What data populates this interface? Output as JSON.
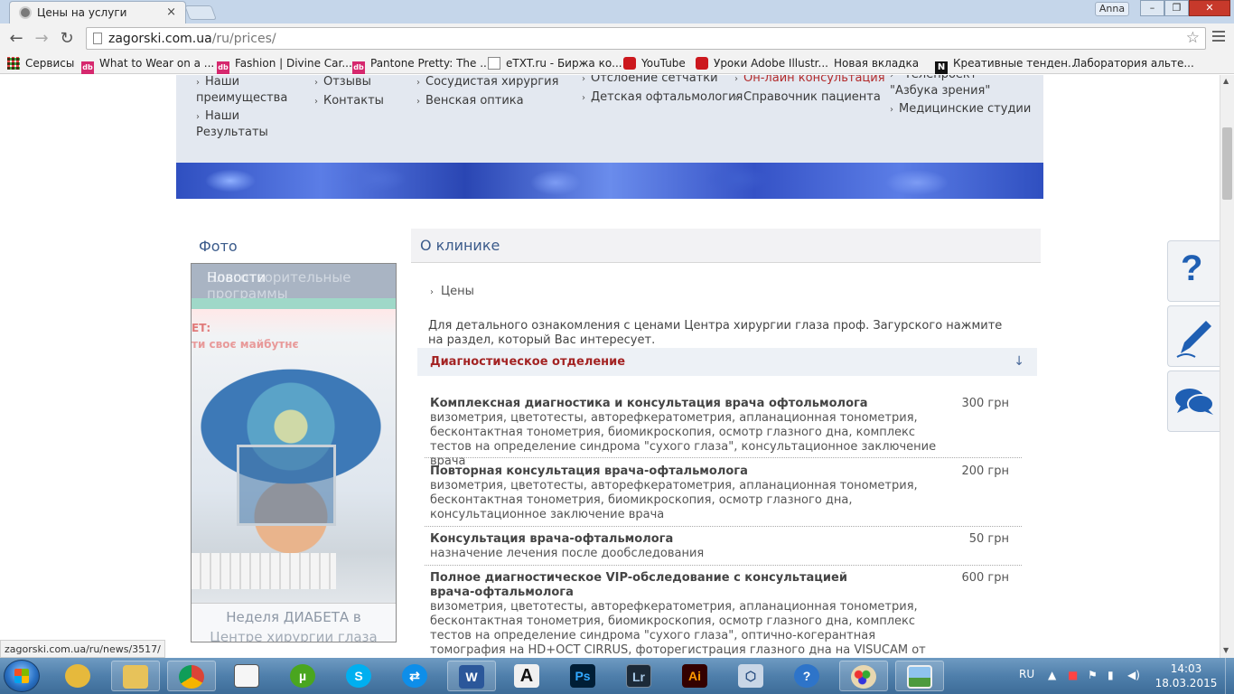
{
  "browser": {
    "tab_title": "Цены на услуги",
    "tab_close": "×",
    "user": "Anna",
    "window_buttons": [
      "–",
      "❐",
      "✕"
    ],
    "url_host": "zagorski.com.ua",
    "url_path": "/ru/prices/",
    "status_url": "zagorski.com.ua/ru/news/3517/"
  },
  "bookmarks": [
    {
      "label": "Сервисы",
      "icon": "apps-grid-icon"
    },
    {
      "label": "What to Wear on a ...",
      "icon": "dd-icon"
    },
    {
      "label": "Fashion | Divine Car...",
      "icon": "dd-icon"
    },
    {
      "label": "Pantone Pretty: The ...",
      "icon": "dd-icon"
    },
    {
      "label": "eTXT.ru - Биржа ко...",
      "icon": "etxt-icon"
    },
    {
      "label": "YouTube",
      "icon": "youtube-icon"
    },
    {
      "label": "Уроки Adobe Illustr...",
      "icon": "youtube-icon"
    },
    {
      "label": "Новая вкладка",
      "icon": "page-icon"
    },
    {
      "label": "Креативные тенден...",
      "icon": "n-icon"
    },
    {
      "label": "Лаборатория альте...",
      "icon": "page-icon"
    }
  ],
  "nav": {
    "col1": [
      "Наши преимущества",
      "Наши Результаты"
    ],
    "col2": [
      "Отзывы",
      "Контакты"
    ],
    "col3": [
      "Сосудистая хирургия",
      "Венская оптика"
    ],
    "col4": [
      "Отслоение сетчатки",
      "Детская офтальмология"
    ],
    "col5": [
      "Он-лайн консультация",
      "Справочник пациента"
    ],
    "col6_partial": "\"Телепроект \"Азбука зрения\"",
    "col6": [
      "Медицинские студии"
    ]
  },
  "sidebar": {
    "title": "Фото",
    "header_line1": "Новости",
    "header_overlay": "Благотворительные программы",
    "image_text1": "ЕТ:",
    "image_text2": "ти своє майбутнє",
    "caption1": "Неделя ДИАБЕТА в",
    "caption2": "Центре хирургии глаза"
  },
  "main": {
    "title": "О клинике",
    "crumb": "Цены",
    "intro": "Для детального ознакомления с ценами Центра хирургии глаза проф. Загурского нажмите на раздел, который Вас интересует.",
    "section_title": "Диагностическое отделение",
    "section_arrow": "↓",
    "rows": [
      {
        "name": "Комплексная диагностика и консультация врача офтольмолога",
        "desc": "визометрия, цветотесты, авторефкератометрия, апланационная тонометрия, бесконтактная тонометрия, биомикроскопия, осмотр глазного дна, комплекс тестов на определение синдрома \"сухого глаза\", консультационное заключение врача",
        "price": "300 грн"
      },
      {
        "name": "Повторная консультация врача-офтальмолога",
        "desc": "визометрия, цветотесты, авторефкератометрия, апланационная тонометрия, бесконтактная тонометрия, биомикроскопия, осмотр глазного дна, консультационное заключение врача",
        "price": "200 грн"
      },
      {
        "name": "Консультация врача-офтальмолога",
        "desc": "назначение лечения после дообследования",
        "price": "50 грн"
      },
      {
        "name": "Полное диагностическое VIP-обследование с консультацией врача-офтальмолога",
        "desc": "визометрия, цветотесты, авторефкератометрия, апланационная тонометрия, бесконтактная тонометрия, биомикроскопия, осмотр глазного дна, комплекс тестов на определение синдрома \"сухого глаза\", оптично-когерантная томография на HD+OCT CIRRUS, фоторегистрация глазного дна на VISUCAM от Carl Zeiss,",
        "price": "600 грн"
      }
    ]
  },
  "float_buttons": [
    "help-question-icon",
    "pen-write-icon",
    "chat-bubbles-icon"
  ],
  "taskbar": {
    "apps": [
      {
        "name": "bird-app",
        "label": ""
      },
      {
        "name": "explorer",
        "label": ""
      },
      {
        "name": "chrome",
        "label": ""
      },
      {
        "name": "notepad",
        "label": ""
      },
      {
        "name": "utorrent",
        "label": "µ"
      },
      {
        "name": "skype",
        "label": "S"
      },
      {
        "name": "teamviewer",
        "label": "⇄"
      },
      {
        "name": "word",
        "label": "W"
      },
      {
        "name": "font-app",
        "label": "A"
      },
      {
        "name": "photoshop",
        "label": "Ps"
      },
      {
        "name": "lightroom",
        "label": "Lr"
      },
      {
        "name": "illustrator",
        "label": "Ai"
      },
      {
        "name": "virtualbox",
        "label": "⬡"
      },
      {
        "name": "help",
        "label": "?"
      },
      {
        "name": "paint",
        "label": ""
      },
      {
        "name": "photo-viewer",
        "label": ""
      }
    ],
    "lang": "RU",
    "time": "14:03",
    "date": "18.03.2015"
  }
}
